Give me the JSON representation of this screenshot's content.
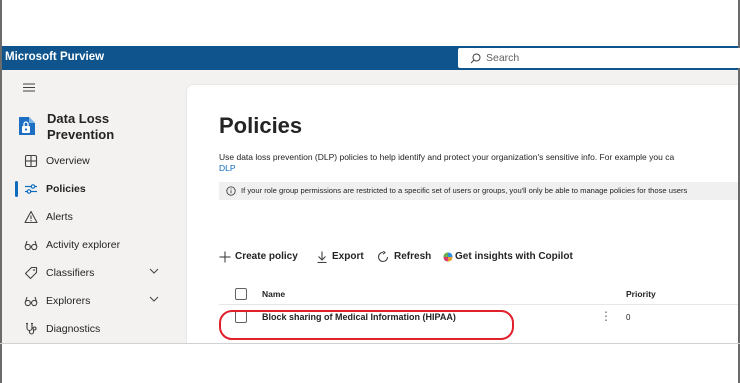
{
  "app": {
    "name": "Microsoft Purview"
  },
  "search": {
    "placeholder": "Search"
  },
  "sidebar": {
    "section_title": "Data Loss Prevention",
    "items": [
      {
        "label": "Overview",
        "icon": "overview-icon"
      },
      {
        "label": "Policies",
        "icon": "policies-icon",
        "active": true
      },
      {
        "label": "Alerts",
        "icon": "alert-icon"
      },
      {
        "label": "Activity explorer",
        "icon": "activity-explorer-icon"
      },
      {
        "label": "Classifiers",
        "icon": "classifiers-icon",
        "expandable": true
      },
      {
        "label": "Explorers",
        "icon": "explorers-icon",
        "expandable": true
      },
      {
        "label": "Diagnostics",
        "icon": "diagnostics-icon"
      }
    ]
  },
  "main": {
    "title": "Policies",
    "description": "Use data loss prevention (DLP) policies to help identify and protect your organization's sensitive info. For example you ca",
    "description_link": "DLP",
    "info": "If your role group permissions are restricted to a specific set of users or groups, you'll only be able to manage policies for those users"
  },
  "toolbar": {
    "create": "Create policy",
    "export": "Export",
    "refresh": "Refresh",
    "copilot": "Get insights with Copilot"
  },
  "table": {
    "columns": [
      "Name",
      "Priority"
    ],
    "rows": [
      {
        "name": "Block sharing of Medical Information (HIPAA)",
        "priority": "0"
      }
    ]
  },
  "colors": {
    "topbar": "#0f548c",
    "accent": "#0f6cbd",
    "highlight": "#e0202a"
  }
}
